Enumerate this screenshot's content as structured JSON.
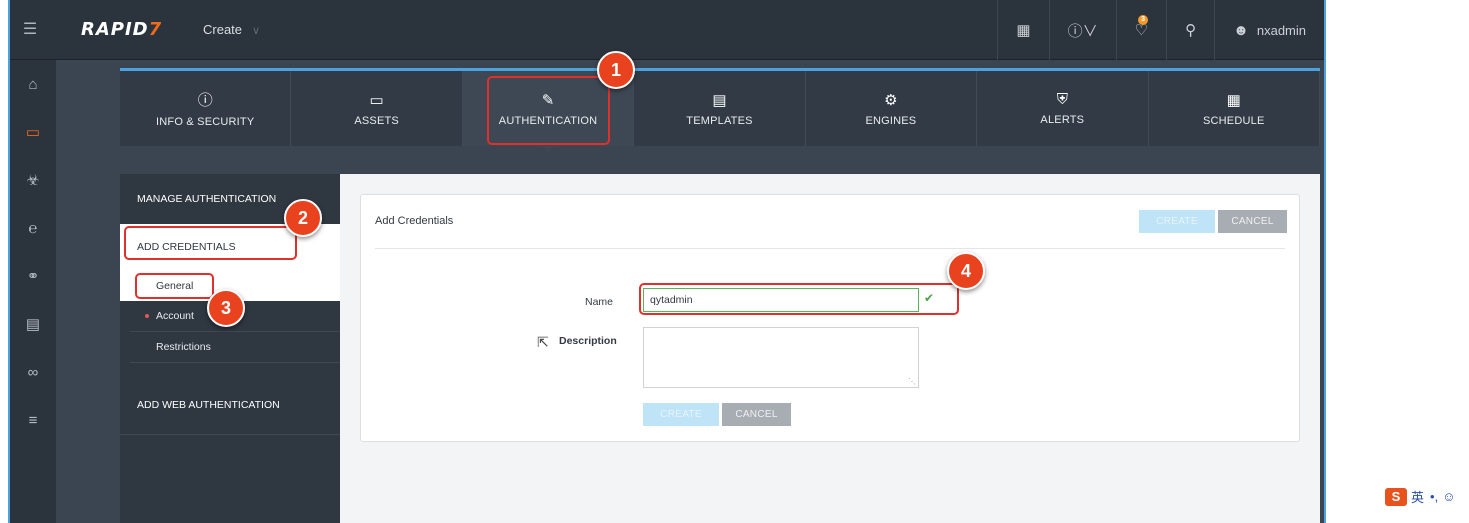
{
  "app": {
    "brand": "RAPID",
    "brand_mark": "7",
    "create_menu": "Create",
    "username": "nxadmin",
    "notification_count": "3"
  },
  "tabs": [
    {
      "label": "INFO & SECURITY",
      "icon": "info-icon"
    },
    {
      "label": "ASSETS",
      "icon": "monitor-icon"
    },
    {
      "label": "AUTHENTICATION",
      "icon": "edit-icon"
    },
    {
      "label": "TEMPLATES",
      "icon": "template-icon"
    },
    {
      "label": "ENGINES",
      "icon": "gears-icon"
    },
    {
      "label": "ALERTS",
      "icon": "shield-icon"
    },
    {
      "label": "SCHEDULE",
      "icon": "calendar-icon"
    }
  ],
  "sidepanel": {
    "manage": "MANAGE AUTHENTICATION",
    "add_credentials": "ADD CREDENTIALS",
    "general": "General",
    "account": "Account",
    "restrictions": "Restrictions",
    "add_web": "ADD WEB AUTHENTICATION"
  },
  "form": {
    "title": "Add Credentials",
    "create_label": "CREATE",
    "cancel_label": "CANCEL",
    "name_label": "Name",
    "name_value": "qytadmin",
    "description_label": "Description"
  },
  "markers": [
    "1",
    "2",
    "3",
    "4"
  ],
  "ime": {
    "label": "英",
    "extra": "•,"
  },
  "colors": {
    "accent": "#4aa3df",
    "brand_orange": "#f06a1c",
    "highlight_red": "#e0302c"
  }
}
